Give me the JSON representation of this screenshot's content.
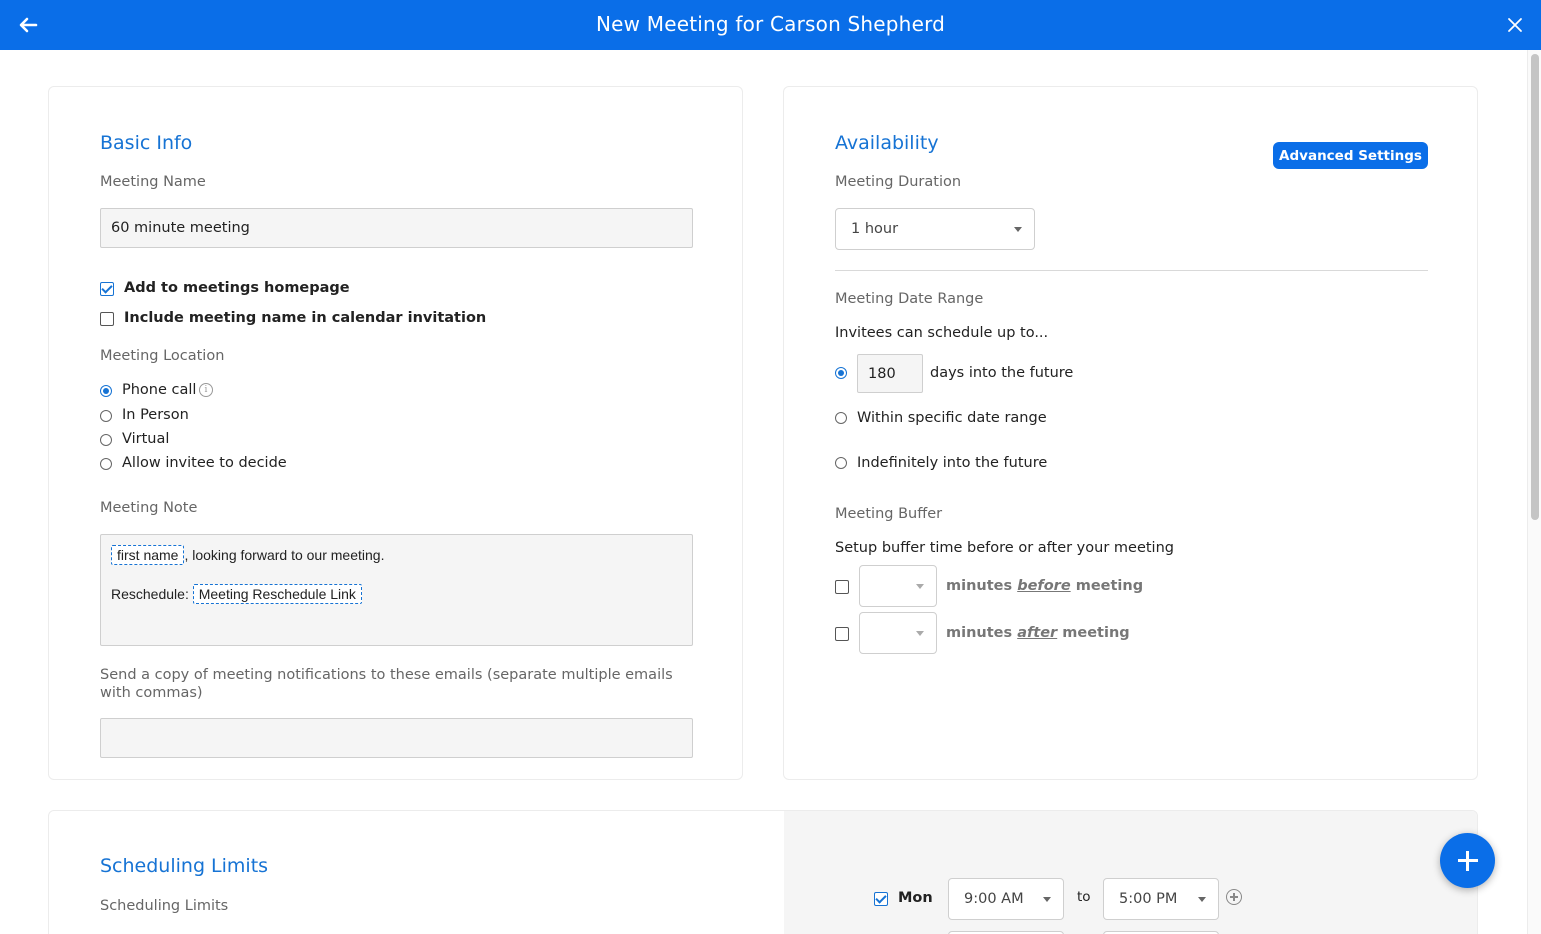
{
  "header": {
    "title": "New Meeting for Carson Shepherd",
    "back_icon": "arrow-left-icon",
    "close_icon": "close-icon",
    "bg_color": "#0a6ee8"
  },
  "basic_info": {
    "section_title": "Basic Info",
    "meeting_name_label": "Meeting Name",
    "meeting_name_value": "60 minute meeting",
    "add_to_homepage": {
      "label": "Add to meetings homepage",
      "checked": true
    },
    "include_name_in_invite": {
      "label": "Include meeting name in calendar invitation",
      "checked": false
    },
    "location_label": "Meeting Location",
    "location_options": [
      {
        "label": "Phone call",
        "selected": true
      },
      {
        "label": "In Person",
        "selected": false
      },
      {
        "label": "Virtual",
        "selected": false
      },
      {
        "label": "Allow invitee to decide",
        "selected": false
      }
    ],
    "note_label": "Meeting Note",
    "note": {
      "token_first_name": "first name",
      "line1_text": ", looking forward to our meeting.",
      "reschedule_prefix": "Reschedule:",
      "token_reschedule_link": "Meeting Reschedule Link"
    },
    "copy_emails_label": "Send a copy of meeting notifications to these emails (separate multiple emails with commas)",
    "copy_emails_value": ""
  },
  "availability": {
    "section_title": "Availability",
    "advanced_settings_label": "Advanced Settings",
    "duration_label": "Meeting Duration",
    "duration_value": "1 hour",
    "date_range_label": "Meeting Date Range",
    "date_range_intro": "Invitees can schedule up to...",
    "days_value": "180",
    "date_range_options": [
      {
        "label": "days into the future",
        "selected": true
      },
      {
        "label": "Within specific date range",
        "selected": false
      },
      {
        "label": "Indefinitely into the future",
        "selected": false
      }
    ],
    "buffer_label": "Meeting Buffer",
    "buffer_intro": "Setup buffer time before or after your meeting",
    "buffer_before": {
      "prefix": "minutes",
      "emphasis": "before",
      "suffix": "meeting",
      "checked": false,
      "value": ""
    },
    "buffer_after": {
      "prefix": "minutes",
      "emphasis": "after",
      "suffix": "meeting",
      "checked": false,
      "value": ""
    }
  },
  "scheduling_limits": {
    "section_title": "Scheduling Limits",
    "sublabel": "Scheduling Limits",
    "hours": [
      {
        "day": "Mon",
        "checked": true,
        "start": "9:00 AM",
        "to_label": "to",
        "end": "5:00 PM"
      }
    ]
  },
  "fab": {
    "icon": "plus-icon"
  }
}
